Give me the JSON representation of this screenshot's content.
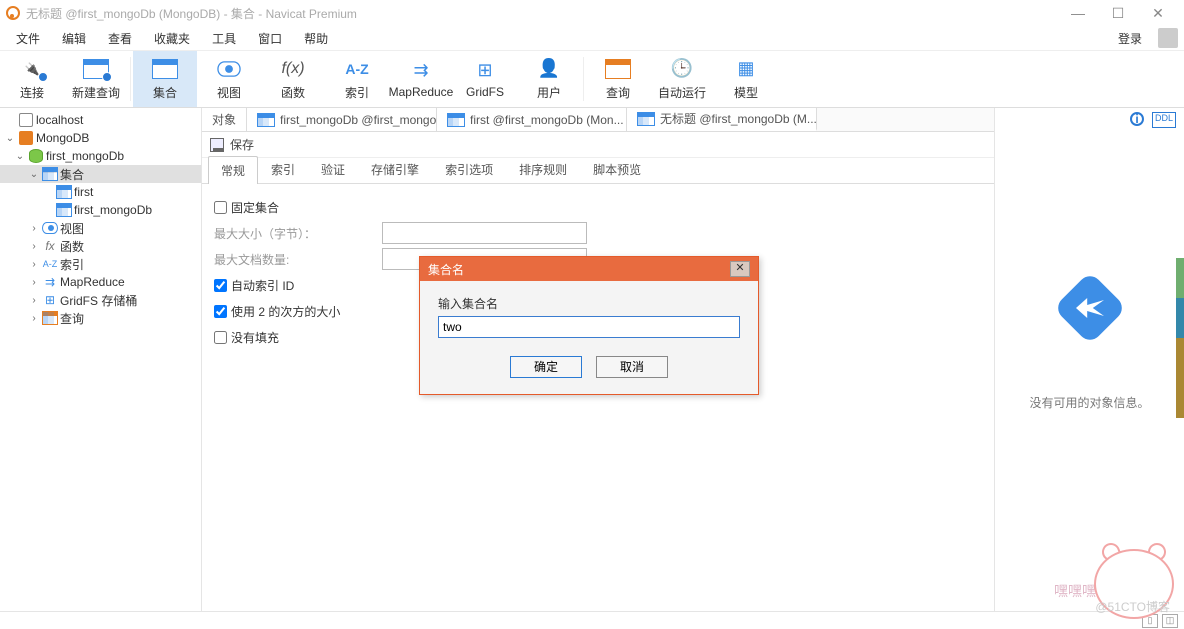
{
  "window": {
    "title": "无标题 @first_mongoDb (MongoDB) - 集合 - Navicat Premium",
    "login_label": "登录"
  },
  "menu": [
    "文件",
    "编辑",
    "查看",
    "收藏夹",
    "工具",
    "窗口",
    "帮助"
  ],
  "toolbar": [
    {
      "label": "连接"
    },
    {
      "label": "新建查询"
    },
    {
      "label": "集合"
    },
    {
      "label": "视图"
    },
    {
      "label": "函数"
    },
    {
      "label": "索引"
    },
    {
      "label": "MapReduce"
    },
    {
      "label": "GridFS"
    },
    {
      "label": "用户"
    },
    {
      "label": "查询"
    },
    {
      "label": "自动运行"
    },
    {
      "label": "模型"
    }
  ],
  "toolbar_text": {
    "fx": "f(x)",
    "az": "A-Z"
  },
  "sidebar": {
    "items": [
      {
        "label": "localhost"
      },
      {
        "label": "MongoDB"
      },
      {
        "label": "first_mongoDb"
      },
      {
        "label": "集合"
      },
      {
        "label": "first"
      },
      {
        "label": "first_mongoDb"
      },
      {
        "label": "视图"
      },
      {
        "label": "函数"
      },
      {
        "label": "索引"
      },
      {
        "label": "MapReduce"
      },
      {
        "label": "GridFS 存储桶"
      },
      {
        "label": "查询"
      }
    ],
    "sublabels": {
      "fx": "fx",
      "az": "A-Z"
    }
  },
  "tabs": [
    {
      "label": "对象"
    },
    {
      "label": "first_mongoDb @first_mongo..."
    },
    {
      "label": "first @first_mongoDb (Mon..."
    },
    {
      "label": "无标题 @first_mongoDb (M..."
    }
  ],
  "subtoolbar": {
    "save": "保存"
  },
  "subtabs": [
    "常规",
    "索引",
    "验证",
    "存储引擎",
    "索引选项",
    "排序规则",
    "脚本预览"
  ],
  "form": {
    "fixed": "固定集合",
    "max_size": "最大大小（字节）：",
    "max_docs": "最大文档数量:",
    "auto_index": "自动索引 ID",
    "power2": "使用 2 的次方的大小",
    "no_pad": "没有填充"
  },
  "rightpanel": {
    "no_info": "没有可用的对象信息。",
    "ddl": "DDL"
  },
  "modal": {
    "title": "集合名",
    "label": "输入集合名",
    "value": "two",
    "ok": "确定",
    "cancel": "取消"
  },
  "watermark": "@51CTO博客",
  "cartoon_text": "嘿嘿嘿嗨～"
}
